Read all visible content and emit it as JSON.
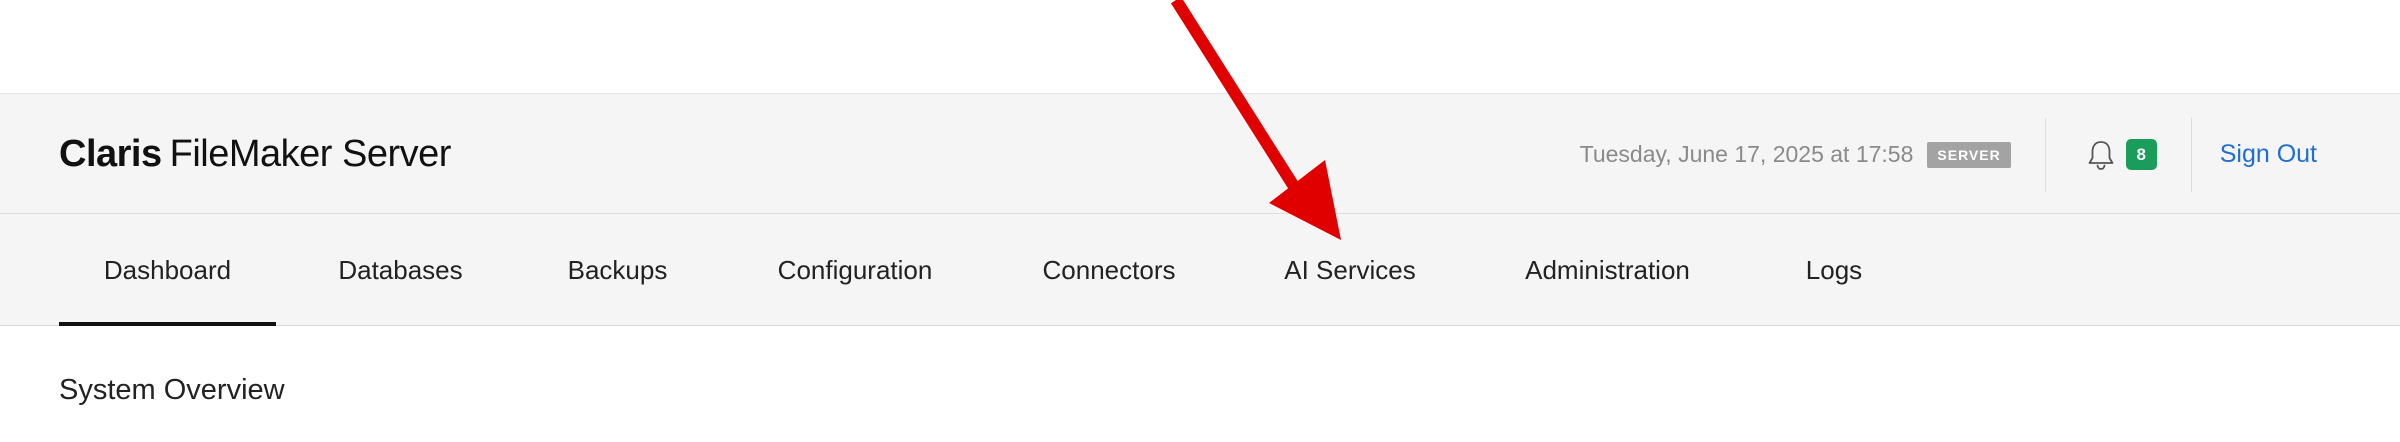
{
  "header": {
    "brand_bold": "Claris",
    "brand_rest": "FileMaker Server",
    "timestamp": "Tuesday, June 17, 2025 at 17:58",
    "server_badge": "SERVER",
    "notification_count": "8",
    "sign_out": "Sign Out"
  },
  "nav": {
    "tabs": [
      {
        "label": "Dashboard",
        "active": true
      },
      {
        "label": "Databases",
        "active": false
      },
      {
        "label": "Backups",
        "active": false
      },
      {
        "label": "Configuration",
        "active": false
      },
      {
        "label": "Connectors",
        "active": false
      },
      {
        "label": "AI Services",
        "active": false
      },
      {
        "label": "Administration",
        "active": false
      },
      {
        "label": "Logs",
        "active": false
      }
    ]
  },
  "main": {
    "section_title": "System Overview"
  },
  "icons": {
    "notifications": "bell-icon",
    "annotation": "arrow-annotation"
  },
  "colors": {
    "header_bg": "#f5f5f5",
    "link": "#1f6fd1",
    "notification_badge": "#1a9c5a",
    "server_badge": "#a3a3a3",
    "annotation_arrow": "#e00000",
    "active_tab_underline": "#111111"
  }
}
